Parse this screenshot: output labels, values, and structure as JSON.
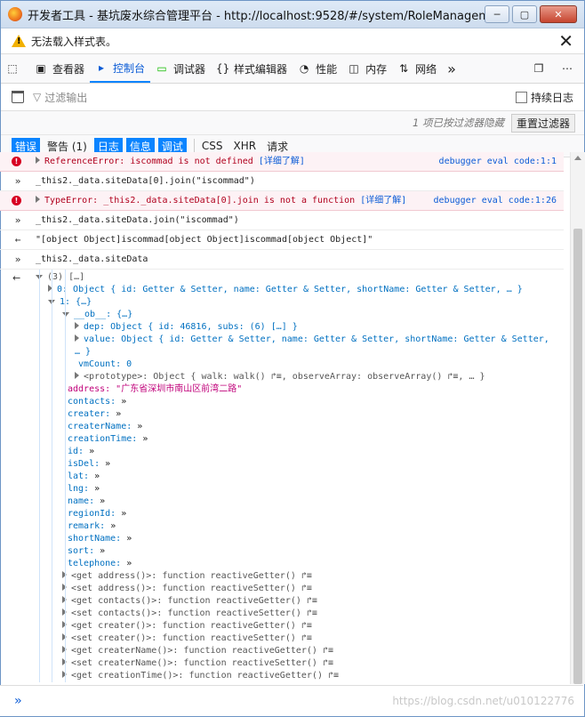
{
  "window": {
    "title": "开发者工具 - 基坑废水综合管理平台 - http://localhost:9528/#/system/RoleManagement",
    "min": "─",
    "max": "▢",
    "close": "✕"
  },
  "notice": {
    "text": "无法载入样式表。",
    "close": "✕"
  },
  "toolbar": {
    "tabs": [
      {
        "label": "查看器",
        "icon": "inspector-icon"
      },
      {
        "label": "控制台",
        "icon": "console-icon"
      },
      {
        "label": "调试器",
        "icon": "debugger-icon"
      },
      {
        "label": "样式编辑器",
        "icon": "style-editor-icon"
      },
      {
        "label": "性能",
        "icon": "performance-icon"
      },
      {
        "label": "内存",
        "icon": "memory-icon"
      },
      {
        "label": "网络",
        "icon": "network-icon"
      }
    ],
    "more": "»"
  },
  "filter": {
    "placeholder": "过滤输出",
    "persist_label": "持续日志"
  },
  "hidden_bar": {
    "text": "1 项已按过滤器隐藏",
    "reset_label": "重置过滤器"
  },
  "categories": [
    "错误",
    "警告 (1)",
    "日志",
    "信息",
    "调试",
    "CSS",
    "XHR",
    "请求"
  ],
  "console": {
    "err1": {
      "text": "ReferenceError: iscommad is not defined",
      "learn": "[详细了解]",
      "src": "debugger eval code:1:1"
    },
    "in1": "_this2._data.siteData[0].join(\"iscommad\")",
    "err2": {
      "text": "TypeError: _this2._data.siteData[0].join is not a function",
      "learn": "[详细了解]",
      "src": "debugger eval code:1:26"
    },
    "in2": "_this2._data.siteData.join(\"iscommad\")",
    "out2": "\"[object Object]iscommad[object Object]iscommad[object Object]\"",
    "in3": "_this2._data.siteData",
    "tree": {
      "root": "(3) […]",
      "item0": "0: Object { id: Getter & Setter, name: Getter & Setter, shortName: Getter & Setter, … }",
      "item1": "1: {…}",
      "ob": "__ob__: {…}",
      "dep": "dep: Object { id: 46816, subs: (6) […] }",
      "value": "value: Object { id: Getter & Setter, name: Getter & Setter, shortName: Getter & Setter,",
      "value_cont": "…  }",
      "vmcount": "vmCount: 0",
      "proto": "<prototype>: Object { walk: walk() ↱≡, observeArray: observeArray() ↱≡, … }",
      "address": "address: \"广东省深圳市南山区前湾二路\"",
      "props": [
        "contacts:",
        "creater:",
        "createrName:",
        "creationTime:",
        "id:",
        "isDel:",
        "lat:",
        "lng:",
        "name:",
        "regionId:",
        "remark:",
        "shortName:",
        "sort:",
        "telephone:"
      ],
      "getset": [
        "<get address()>: function reactiveGetter() ↱≡",
        "<set address()>: function reactiveSetter() ↱≡",
        "<get contacts()>: function reactiveGetter() ↱≡",
        "<set contacts()>: function reactiveSetter() ↱≡",
        "<get creater()>: function reactiveGetter() ↱≡",
        "<set creater()>: function reactiveSetter() ↱≡",
        "<get createrName()>: function reactiveGetter() ↱≡",
        "<set createrName()>: function reactiveSetter() ↱≡",
        "<get creationTime()>: function reactiveGetter() ↱≡"
      ]
    }
  },
  "input": {
    "prompt": "»",
    "watermark": "https://blog.csdn.net/u010122776"
  }
}
